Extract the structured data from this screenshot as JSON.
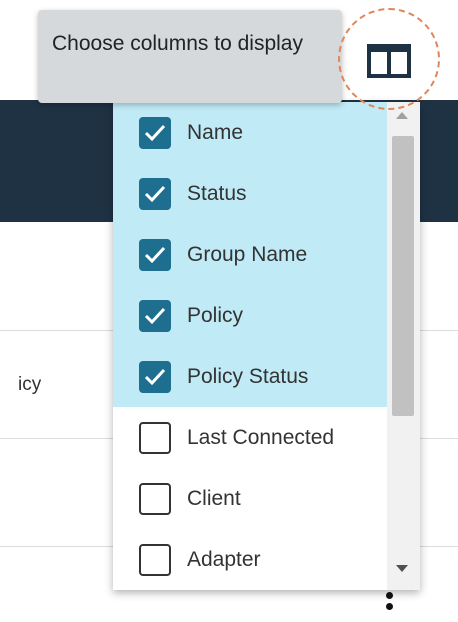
{
  "tooltip": {
    "text": "Choose columns to display"
  },
  "columns_button": {
    "icon": "columns-icon"
  },
  "background": {
    "cell_text": "icy"
  },
  "colors": {
    "checked_bg": "#bfeaf6",
    "checkbox_on": "#1e6f8f",
    "header_dark": "#1f3244",
    "focus_ring": "#e0865a"
  },
  "columns": [
    {
      "label": "Name",
      "checked": true
    },
    {
      "label": "Status",
      "checked": true
    },
    {
      "label": "Group Name",
      "checked": true
    },
    {
      "label": "Policy",
      "checked": true
    },
    {
      "label": "Policy Status",
      "checked": true
    },
    {
      "label": "Last Connected",
      "checked": false
    },
    {
      "label": "Client",
      "checked": false
    },
    {
      "label": "Adapter",
      "checked": false
    }
  ]
}
